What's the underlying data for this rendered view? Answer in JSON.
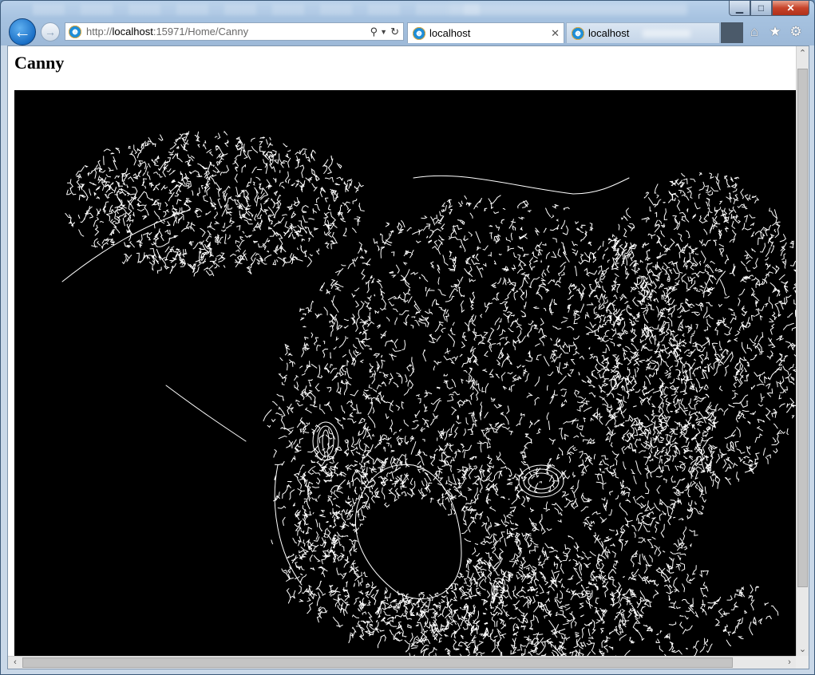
{
  "window": {
    "controls": {
      "minimize": "▁",
      "maximize": "□",
      "close": "✕"
    }
  },
  "toolbar": {
    "back_glyph": "←",
    "forward_glyph": "→",
    "address": {
      "scheme": "http://",
      "host": "localhost",
      "rest": ":15971/Home/Canny"
    },
    "search_glyph": "⚲",
    "dropdown_glyph": "▼",
    "refresh_glyph": "↻"
  },
  "tabs": [
    {
      "label": "localhost",
      "active": true,
      "close": "✕"
    },
    {
      "label": "localhost",
      "active": false
    }
  ],
  "command_icons": {
    "home": "⌂",
    "favorites": "★",
    "tools": "⚙"
  },
  "page": {
    "title": "Canny"
  },
  "scrollbars": {
    "up": "⌃",
    "down": "⌄",
    "left": "‹",
    "right": "›"
  },
  "icons": [
    "back-arrow-icon",
    "forward-arrow-icon",
    "ie-logo-icon",
    "search-icon",
    "refresh-icon",
    "home-icon",
    "star-icon",
    "gear-icon"
  ]
}
